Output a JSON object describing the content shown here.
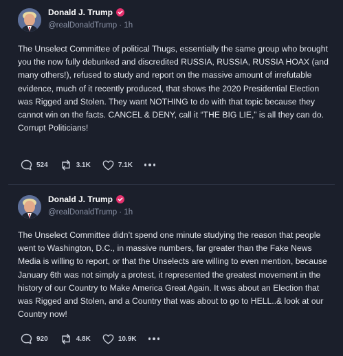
{
  "posts": [
    {
      "author": {
        "name": "Donald J. Trump",
        "handle": "@realDonaldTrump · 1h"
      },
      "text": "The Unselect Committee of political Thugs, essentially the same group who brought you the now fully debunked and discredited RUSSIA, RUSSIA, RUSSIA HOAX (and many others!), refused to study and report on the massive amount of irrefutable evidence, much of it recently produced, that shows the 2020 Presidential Election was Rigged and Stolen. They want NOTHING to do with that topic because they cannot win on the facts. CANCEL & DENY, call it “THE BIG LIE,” is all they can do. Corrupt Politicians!",
      "stats": {
        "replies": "524",
        "retruths": "3.1K",
        "likes": "7.1K"
      }
    },
    {
      "author": {
        "name": "Donald J. Trump",
        "handle": "@realDonaldTrump · 1h"
      },
      "text": "The Unselect Committee didn’t spend one minute studying the reason that people went to Washington, D.C., in massive numbers, far greater than the Fake News Media is willing to report, or that the Unselects are willing to even mention, because January 6th was not simply a protest, it represented the greatest movement in the history of our Country to Make America Great Again. It was about an Election that was Rigged and Stolen, and a Country that was about to go to HELL..& look at our Country now!",
      "stats": {
        "replies": "920",
        "retruths": "4.8K",
        "likes": "10.9K"
      }
    }
  ],
  "colors": {
    "background": "#1b1f2b",
    "verified_badge": "#e5306d",
    "muted_text": "#8b93a7"
  },
  "icons": [
    "verified-badge-icon",
    "reply-icon",
    "retruth-icon",
    "like-icon",
    "more-options-icon"
  ]
}
